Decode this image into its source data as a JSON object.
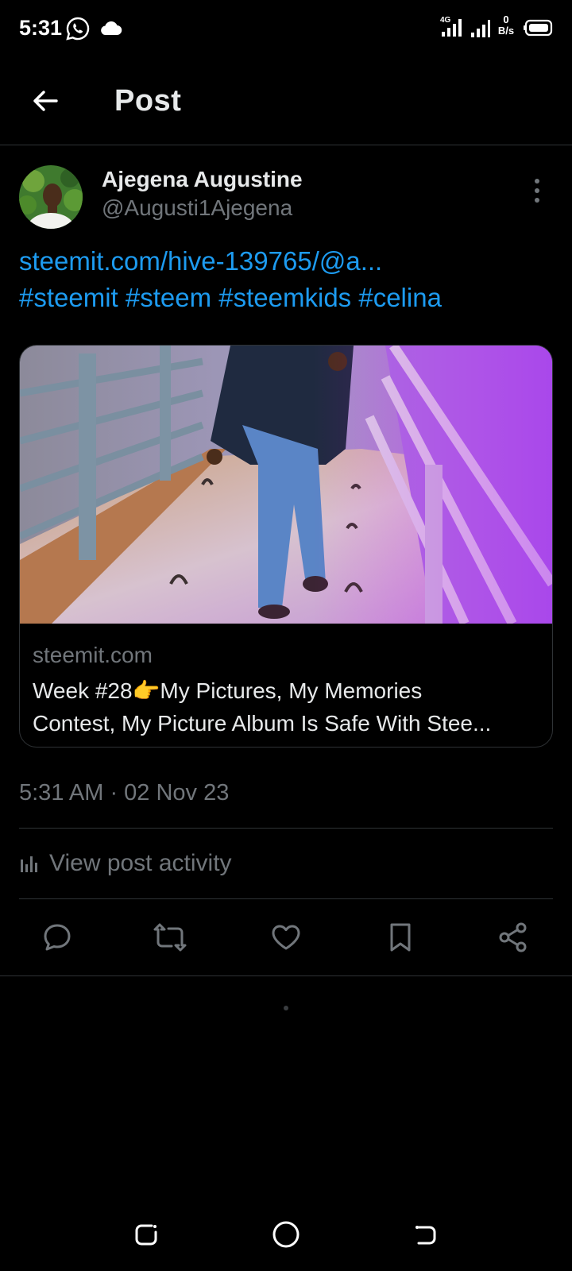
{
  "status_bar": {
    "time": "5:31",
    "net_speed_value": "0",
    "net_speed_unit": "B/s",
    "network_type": "4G",
    "icons": [
      "whatsapp-icon",
      "cloud-icon",
      "signal-icon",
      "battery-icon"
    ]
  },
  "header": {
    "title": "Post",
    "back_icon": "arrow-left-icon"
  },
  "post": {
    "author_name": "Ajegena Augustine",
    "author_handle": "@Augusti1Ajegena",
    "link_text": "steemit.com/hive-139765/@a...",
    "hashtags": "#steemit #steem #steemkids #celina",
    "card": {
      "domain": "steemit.com",
      "title_line1": "Week #28👉My Pictures, My Memories",
      "title_line2": "Contest, My Picture Album Is Safe With Stee..."
    },
    "timestamp": "5:31 AM · 02 Nov 23",
    "activity_label": "View post activity"
  },
  "actions": [
    "reply-icon",
    "repost-icon",
    "like-icon",
    "bookmark-icon",
    "share-icon"
  ],
  "colors": {
    "background": "#000000",
    "link": "#1d9bf0",
    "primary_text": "#e7e9ea",
    "secondary_text": "#71767b",
    "border": "#2f3336"
  }
}
